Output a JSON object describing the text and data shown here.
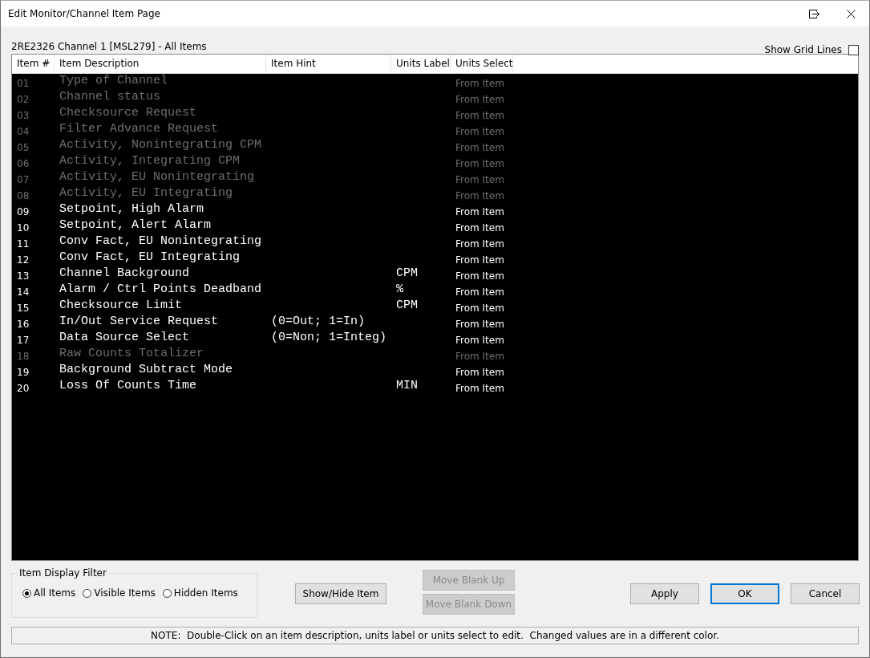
{
  "window": {
    "title": "Edit Monitor/Channel Item Page"
  },
  "subtitle": "2RE2326 Channel 1 [MSL279] - All Items",
  "show_grid_lines": {
    "label": "Show Grid Lines",
    "checked": false
  },
  "table": {
    "columns": [
      "Item #",
      "Item Description",
      "Item Hint",
      "Units Label",
      "Units Select"
    ],
    "rows": [
      {
        "num": "01",
        "description": "Type of Channel",
        "hint": "",
        "units_label": "",
        "units_select": "From Item",
        "hidden": true
      },
      {
        "num": "02",
        "description": "Channel status",
        "hint": "",
        "units_label": "",
        "units_select": "From Item",
        "hidden": true
      },
      {
        "num": "03",
        "description": "Checksource Request",
        "hint": "",
        "units_label": "",
        "units_select": "From Item",
        "hidden": true
      },
      {
        "num": "04",
        "description": "Filter Advance Request",
        "hint": "",
        "units_label": "",
        "units_select": "From Item",
        "hidden": true
      },
      {
        "num": "05",
        "description": "Activity, Nonintegrating CPM",
        "hint": "",
        "units_label": "",
        "units_select": "From Item",
        "hidden": true
      },
      {
        "num": "06",
        "description": "Activity, Integrating CPM",
        "hint": "",
        "units_label": "",
        "units_select": "From Item",
        "hidden": true
      },
      {
        "num": "07",
        "description": "Activity, EU Nonintegrating",
        "hint": "",
        "units_label": "",
        "units_select": "From Item",
        "hidden": true
      },
      {
        "num": "08",
        "description": "Activity, EU Integrating",
        "hint": "",
        "units_label": "",
        "units_select": "From Item",
        "hidden": true
      },
      {
        "num": "09",
        "description": "Setpoint, High Alarm",
        "hint": "",
        "units_label": "",
        "units_select": "From Item",
        "hidden": false
      },
      {
        "num": "10",
        "description": "Setpoint, Alert Alarm",
        "hint": "",
        "units_label": "",
        "units_select": "From Item",
        "hidden": false
      },
      {
        "num": "11",
        "description": "Conv Fact, EU Nonintegrating",
        "hint": "",
        "units_label": "",
        "units_select": "From Item",
        "hidden": false
      },
      {
        "num": "12",
        "description": "Conv Fact, EU Integrating",
        "hint": "",
        "units_label": "",
        "units_select": "From Item",
        "hidden": false
      },
      {
        "num": "13",
        "description": "Channel Background",
        "hint": "",
        "units_label": "CPM",
        "units_select": "From Item",
        "hidden": false
      },
      {
        "num": "14",
        "description": "Alarm / Ctrl Points Deadband",
        "hint": "",
        "units_label": "%",
        "units_select": "From Item",
        "hidden": false
      },
      {
        "num": "15",
        "description": "Checksource Limit",
        "hint": "",
        "units_label": "CPM",
        "units_select": "From Item",
        "hidden": false
      },
      {
        "num": "16",
        "description": "In/Out Service Request",
        "hint": "(0=Out; 1=In)",
        "units_label": "",
        "units_select": "From Item",
        "hidden": false
      },
      {
        "num": "17",
        "description": "Data Source Select",
        "hint": "(0=Non; 1=Integ)",
        "units_label": "",
        "units_select": "From Item",
        "hidden": false
      },
      {
        "num": "18",
        "description": "Raw Counts Totalizer",
        "hint": "",
        "units_label": "",
        "units_select": "From Item",
        "hidden": true
      },
      {
        "num": "19",
        "description": "Background Subtract Mode",
        "hint": "",
        "units_label": "",
        "units_select": "From Item",
        "hidden": false
      },
      {
        "num": "20",
        "description": "Loss Of Counts Time",
        "hint": "",
        "units_label": "MIN",
        "units_select": "From Item",
        "hidden": false
      }
    ]
  },
  "filter": {
    "title": "Item Display Filter",
    "options": [
      {
        "label": "All Items",
        "selected": true
      },
      {
        "label": "Visible Items",
        "selected": false
      },
      {
        "label": "Hidden Items",
        "selected": false
      }
    ]
  },
  "buttons": [
    {
      "label": "Show/Hide Item",
      "kind": "middle",
      "disabled": false,
      "default": false
    },
    {
      "label": "Move Blank Up",
      "kind": "stack",
      "disabled": true,
      "default": false
    },
    {
      "label": "Move Blank Down",
      "kind": "stack",
      "disabled": true,
      "default": false
    },
    {
      "label": "Apply",
      "kind": "dialog",
      "disabled": false,
      "default": false
    },
    {
      "label": "OK",
      "kind": "dialog",
      "disabled": false,
      "default": true
    },
    {
      "label": "Cancel",
      "kind": "dialog",
      "disabled": false,
      "default": false
    }
  ],
  "note": "NOTE:  Double-Click on an item description, units label or units select to edit.  Changed values are in a different color."
}
